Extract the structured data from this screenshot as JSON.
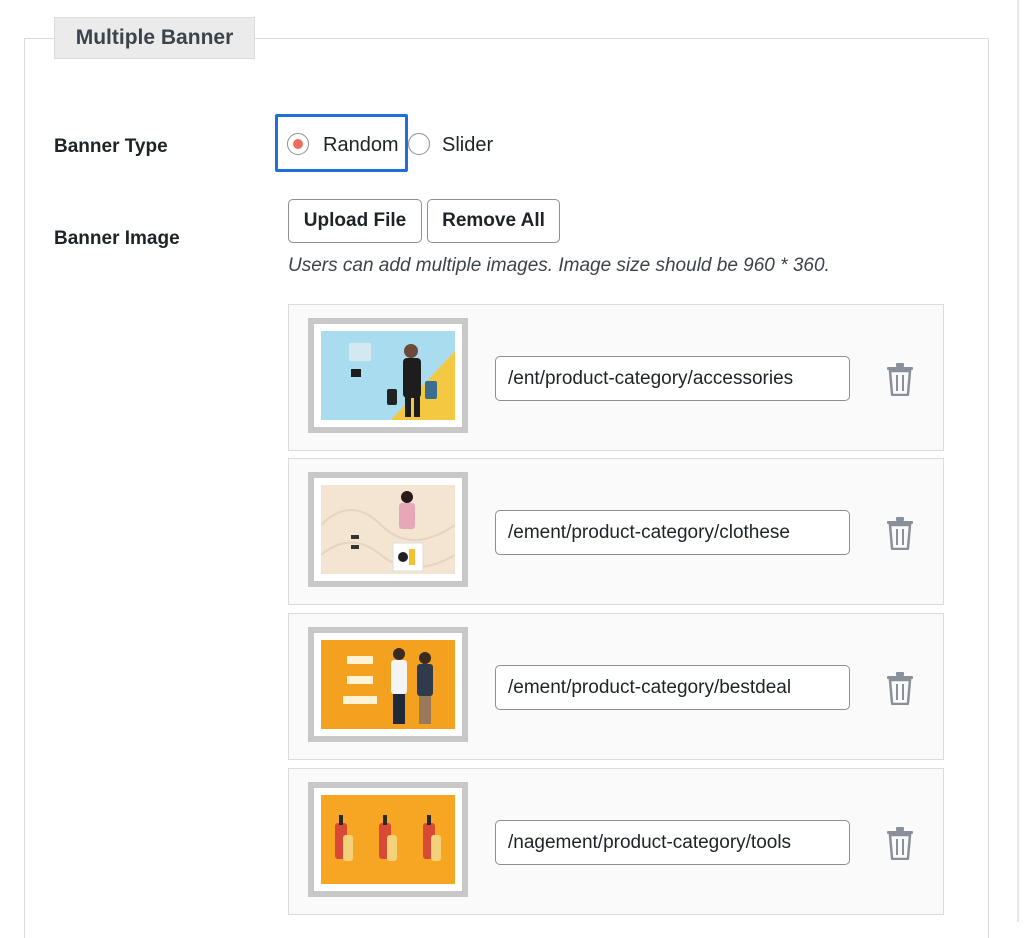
{
  "section": {
    "legend": "Multiple Banner"
  },
  "banner_type": {
    "label": "Banner Type",
    "options": [
      {
        "label": "Random",
        "checked": true
      },
      {
        "label": "Slider",
        "checked": false
      }
    ]
  },
  "banner_image": {
    "label": "Banner Image",
    "upload_label": "Upload File",
    "remove_all_label": "Remove All",
    "help_text": "Users can add multiple images. Image size should be 960 * 360.",
    "items": [
      {
        "url_display": "ent/product-category/accessories/",
        "thumb_bg": "#a9dcef",
        "thumb_accent": "#f5c842"
      },
      {
        "url_display": "ement/product-category/clothese/",
        "thumb_bg": "#f3e5d2",
        "thumb_accent": "#e8c7b8"
      },
      {
        "url_display": "ement/product-category/bestdeal/",
        "thumb_bg": "#f3a11f",
        "thumb_accent": "#ffffff"
      },
      {
        "url_display": "nagement/product-category/tools/",
        "thumb_bg": "#f6a622",
        "thumb_accent": "#d84a35"
      }
    ]
  },
  "colors": {
    "radio_dot": "#ef6d5c",
    "focus_ring": "#1e6fd9",
    "trash": "#8a9099"
  },
  "icons": {
    "delete": "trash-icon"
  }
}
